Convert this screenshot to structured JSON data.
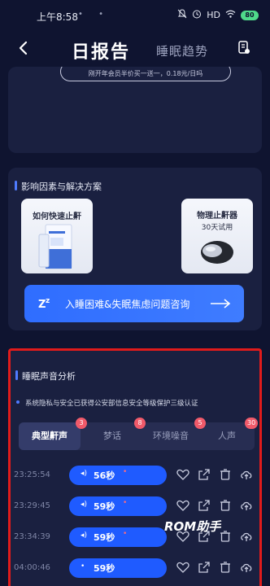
{
  "status": {
    "time": "上午8:58",
    "dots": "• •",
    "signal": "HD",
    "battery": "80"
  },
  "header": {
    "tab_daily": "日报告",
    "tab_trend": "睡眠趋势"
  },
  "promo": {
    "text": "刚开年会员半价买一送一，0.18元/日吗"
  },
  "factors": {
    "title": "影响因素与解决方案",
    "card1_title": "如何快速止鼾",
    "card2_title": "物理止鼾器",
    "card2_sub": "30天试用",
    "consult_label": "入睡困难&失眠焦虑问题咨询"
  },
  "sound": {
    "title": "睡眠声音分析",
    "privacy": "系统隐私与安全已获得公安部信息安全等级保护三级认证",
    "tabs": [
      {
        "label": "典型鼾声",
        "badge": "3"
      },
      {
        "label": "梦话",
        "badge": "8"
      },
      {
        "label": "环境噪音",
        "badge": "5"
      },
      {
        "label": "人声",
        "badge": "30"
      }
    ],
    "records": [
      {
        "time": "23:25:54",
        "duration": "56秒"
      },
      {
        "time": "23:29:45",
        "duration": "59秒"
      },
      {
        "time": "23:34:39",
        "duration": "59秒"
      },
      {
        "time": "04:00:46",
        "duration": "59秒"
      }
    ]
  },
  "watermark": "ROM助手",
  "colors": {
    "accent": "#2f6dff",
    "highlight_border": "#e01b1b",
    "badge": "#f05a6a",
    "bg": "#0f1430"
  }
}
